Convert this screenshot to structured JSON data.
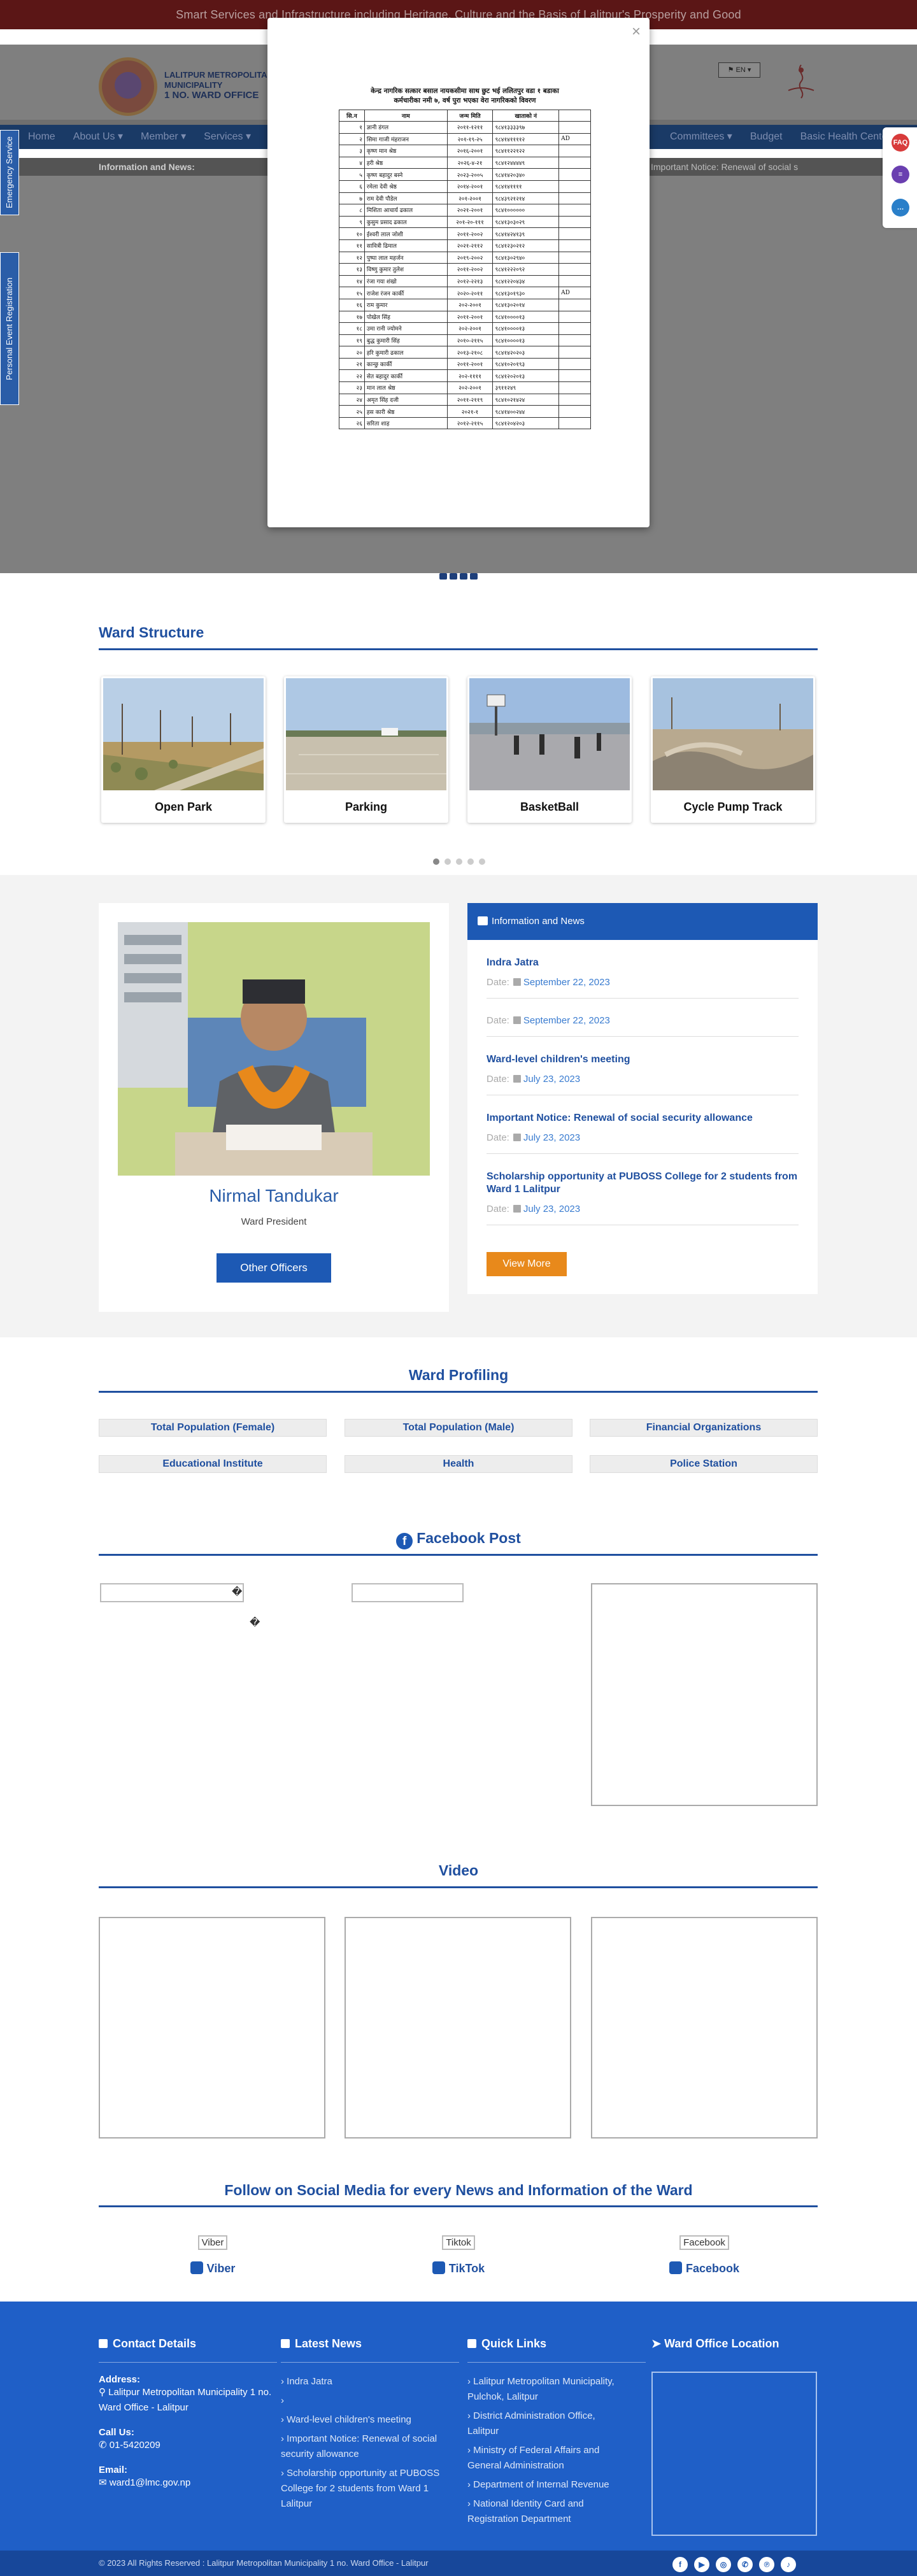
{
  "topbar": {
    "tagline": "Smart Services and Infrastructure including Heritage, Culture and the Basis of Lalitpur's Prosperity and Good"
  },
  "header": {
    "org_line1": "LALITPUR METROPOLITAN",
    "org_line2": "MUNICIPALITY",
    "org_line3": "1 NO. WARD OFFICE",
    "lang": "EN"
  },
  "nav": {
    "left": [
      "Home",
      "About Us",
      "Member",
      "Services"
    ],
    "right": [
      "Committees",
      "Budget",
      "Basic Health Center"
    ]
  },
  "ticker": {
    "label": "Information and News:",
    "message": "Important Notice: Renewal of social s"
  },
  "side_tabs": {
    "emergency": "Emergency Service",
    "personal_event": "Personal Event Registration"
  },
  "float_icons": {
    "faq": "FAQ"
  },
  "modal": {
    "close": "×",
    "doc_title_line1": "केन्द्र नागरिक सत्कार बसाल नायकसीमा साथ छुट भई ललितपुर वडा १ बडाका",
    "doc_title_line2": "कर्मचारीका नमी ७, वर्ष पुरा भएका वेरा नागरिकको विवरण",
    "columns": [
      "सि.न",
      "नाम",
      "जन्म मिति",
      "खाताको नं",
      ""
    ],
    "rows": [
      [
        "१",
        "ज्ञानी डंगल",
        "२०११-१२११",
        "९८४१३३३३९७",
        ""
      ],
      [
        "२",
        "सिमा गाजी मंहराजन",
        "२०१-१९-२५",
        "९८४१४११११२",
        "AD"
      ],
      [
        "३",
        "कृष्ण मान श्रेष्ठ",
        "२०१६-२००१",
        "९८४११२२१२२",
        ""
      ],
      [
        "४",
        "हरी श्रेष्ठ",
        "२०२६-४-२१",
        "९८४१२४४४४९",
        ""
      ],
      [
        "५",
        "कृष्ण बहादुर बस्ने",
        "२०२३-२००५",
        "९८४१४२०३४०",
        ""
      ],
      [
        "६",
        "रमेला देवी श्रेष्ठ",
        "२०१४-२००१",
        "९८४१४११११",
        ""
      ],
      [
        "७",
        "राम देवी पौडेल",
        "२०१-२००१",
        "९८४३९२१२१४",
        ""
      ],
      [
        "८",
        "मिशिता आचार्य ढकाल",
        "२०२१-२००१",
        "९८४१००००००",
        ""
      ],
      [
        "९",
        "कुसुम प्रसाद ढकाल",
        "२०१-२०-१११",
        "९८४१३०३०२९",
        ""
      ],
      [
        "१०",
        "ईश्वरी लाल जोशी",
        "२०११-२००२",
        "९८४१४२४१३९",
        ""
      ],
      [
        "११",
        "सावित्री ढिमाल",
        "२०२१-२११२",
        "९८४१२३०२१२",
        ""
      ],
      [
        "१२",
        "पुष्पा लाल महर्जन",
        "२०१९-२००२",
        "९८४१३०२९४०",
        ""
      ],
      [
        "१३",
        "विष्णु कुमार तुलेश",
        "२०११-२००२",
        "९८४१२२२०९२",
        ""
      ],
      [
        "१४",
        "रंजा गया शंखो",
        "२०१२-२२१३",
        "९८४१२२०४३४",
        ""
      ],
      [
        "१५",
        "राजेश रंजन कार्की",
        "२०२०-२०११",
        "९८४१३०१९३०",
        "AD"
      ],
      [
        "१६",
        "राम कुमार",
        "२०२-२००१",
        "९८४१३०२०१४",
        ""
      ],
      [
        "१७",
        "पोखेल सिंह",
        "२०११-२००१",
        "९८४१००००१३",
        ""
      ],
      [
        "१८",
        "उमा रानी ज्योमने",
        "२०२-२००१",
        "९८४१००००१३",
        ""
      ],
      [
        "१९",
        "बुद्ध कुमारी सिंह",
        "२०१०-२११५",
        "९८४१००००१३",
        ""
      ],
      [
        "२०",
        "हरि कुमारी ढकाल",
        "२०१३-२१०८",
        "९८४१४२०२०३",
        ""
      ],
      [
        "२१",
        "कान्छु कार्की",
        "२०११-२००१",
        "९८४१०२०१९३",
        ""
      ],
      [
        "२२",
        "सेत बहादुर कार्की",
        "२०२-११११",
        "९८४१२०२०१३",
        ""
      ],
      [
        "२३",
        "मान लाल श्रेष्ठ",
        "२०२-२००१",
        "३९११२४९",
        ""
      ],
      [
        "२४",
        "अमृत सिंह दजी",
        "२०११-२११९",
        "९८४१०२१४२४",
        ""
      ],
      [
        "२५",
        "हस कारी श्रेष्ठ",
        "२०२१-१",
        "९८४१४००२४४",
        ""
      ],
      [
        "२६",
        "सरिता शाह",
        "२०१२-२११५",
        "९८४१२०४२०३",
        ""
      ]
    ]
  },
  "ward_structure": {
    "title": "Ward Structure",
    "cards": [
      {
        "label": "Open Park"
      },
      {
        "label": "Parking"
      },
      {
        "label": "BasketBall"
      },
      {
        "label": "Cycle Pump Track"
      }
    ]
  },
  "president": {
    "name": "Nirmal Tandukar",
    "role": "Ward President",
    "button": "Other Officers"
  },
  "info": {
    "header": "Information and News",
    "date_prefix": "Date:",
    "items": [
      {
        "title": "Indra Jatra",
        "date": "September 22, 2023"
      },
      {
        "title": "",
        "date": "September 22, 2023"
      },
      {
        "title": "Ward-level children's meeting",
        "date": "July 23, 2023"
      },
      {
        "title": "Important Notice: Renewal of social security allowance",
        "date": "July 23, 2023"
      },
      {
        "title": "Scholarship opportunity at PUBOSS College for 2 students from Ward 1 Lalitpur",
        "date": "July 23, 2023"
      }
    ],
    "button": "View More"
  },
  "ward_profiling": {
    "title": "Ward Profiling",
    "items": [
      "Total Population (Female)",
      "Total Population (Male)",
      "Financial Organizations",
      "Educational Institute",
      "Health",
      "Police Station"
    ]
  },
  "facebook": {
    "title": "Facebook Post",
    "icon": "f",
    "glyph1": "�",
    "glyph2": "�"
  },
  "video": {
    "title": "Video"
  },
  "social": {
    "title": "Follow on Social Media for every News and Information of the Ward",
    "items": [
      {
        "alt": "Viber",
        "name": "Viber"
      },
      {
        "alt": "Tiktok",
        "name": "TikTok"
      },
      {
        "alt": "Facebook",
        "name": "Facebook"
      }
    ]
  },
  "footer": {
    "contact_title": "Contact Details",
    "address_label": "Address:",
    "address": "Lalitpur Metropolitan Municipality 1 no. Ward Office - Lalitpur",
    "call_label": "Call Us:",
    "phone": "01-5420209",
    "email_label": "Email:",
    "email": "ward1@lmc.gov.np",
    "news_title": "Latest News",
    "news": [
      "Indra Jatra",
      "",
      "Ward-level children's meeting",
      "Important Notice: Renewal of social security allowance",
      "Scholarship opportunity at PUBOSS College for 2 students from Ward 1 Lalitpur"
    ],
    "links_title": "Quick Links",
    "links": [
      "Lalitpur Metropolitan Municipality, Pulchok, Lalitpur",
      "District Administration Office, Lalitpur",
      "Ministry of Federal Affairs and General Administration",
      "Department of Internal Revenue",
      "National Identity Card and Registration Department"
    ],
    "location_title": "Ward Office Location",
    "copyright": "© 2023 All Rights Reserved : Lalitpur Metropolitan Municipality 1 no. Ward Office - Lalitpur",
    "social_icons": [
      "f",
      "▶",
      "◎",
      "✆",
      "℗",
      "♪"
    ]
  },
  "colors": {
    "primary": "#1f4f9f",
    "button_blue": "#1d59b4",
    "orange": "#e8891b",
    "footer": "#1f5fc7"
  }
}
